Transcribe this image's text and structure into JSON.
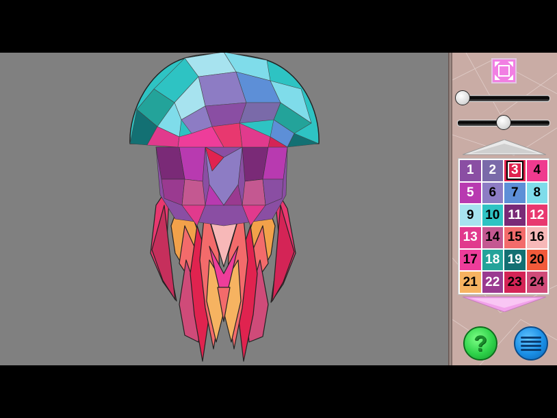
{
  "canvas": {
    "background": "#808080",
    "picture": "jellyfish-polygon-art"
  },
  "toolbar": {
    "fit_icon": "fit-to-screen-icon",
    "zoom_level": 0.06,
    "brightness_level": 0.5,
    "scroll_up_icon": "triangle-up-icon",
    "scroll_down_icon": "triangle-down-icon",
    "hint_icon": "question-mark-icon",
    "hint_label": "?",
    "menu_icon": "hamburger-menu-icon"
  },
  "palette": {
    "selected": 3,
    "swatches": [
      {
        "num": "1",
        "bg": "#8a4ea3",
        "fg": "#ffffff"
      },
      {
        "num": "2",
        "bg": "#7a6aa9",
        "fg": "#ffffff"
      },
      {
        "num": "3",
        "bg": "#e0234f",
        "fg": "#ffffff"
      },
      {
        "num": "4",
        "bg": "#ef3b8f",
        "fg": "#000000"
      },
      {
        "num": "5",
        "bg": "#b83ab0",
        "fg": "#ffffff"
      },
      {
        "num": "6",
        "bg": "#8d7cc4",
        "fg": "#000000"
      },
      {
        "num": "7",
        "bg": "#5d8fd7",
        "fg": "#000000"
      },
      {
        "num": "8",
        "bg": "#7fdcea",
        "fg": "#000000"
      },
      {
        "num": "9",
        "bg": "#a7e3ef",
        "fg": "#000000"
      },
      {
        "num": "10",
        "bg": "#2ec3c3",
        "fg": "#000000"
      },
      {
        "num": "11",
        "bg": "#7a2a77",
        "fg": "#ffffff"
      },
      {
        "num": "12",
        "bg": "#e8386f",
        "fg": "#ffffff"
      },
      {
        "num": "13",
        "bg": "#e13a8d",
        "fg": "#ffffff"
      },
      {
        "num": "14",
        "bg": "#c45891",
        "fg": "#000000"
      },
      {
        "num": "15",
        "bg": "#f36b6b",
        "fg": "#000000"
      },
      {
        "num": "16",
        "bg": "#f7b8b8",
        "fg": "#000000"
      },
      {
        "num": "17",
        "bg": "#ee3d9a",
        "fg": "#000000"
      },
      {
        "num": "18",
        "bg": "#23a39a",
        "fg": "#ffffff"
      },
      {
        "num": "19",
        "bg": "#137073",
        "fg": "#ffffff"
      },
      {
        "num": "20",
        "bg": "#f25a3a",
        "fg": "#000000"
      },
      {
        "num": "21",
        "bg": "#f6b361",
        "fg": "#000000"
      },
      {
        "num": "22",
        "bg": "#9a3a90",
        "fg": "#ffffff"
      },
      {
        "num": "23",
        "bg": "#d42456",
        "fg": "#000000"
      },
      {
        "num": "24",
        "bg": "#cf4b79",
        "fg": "#000000"
      }
    ]
  }
}
